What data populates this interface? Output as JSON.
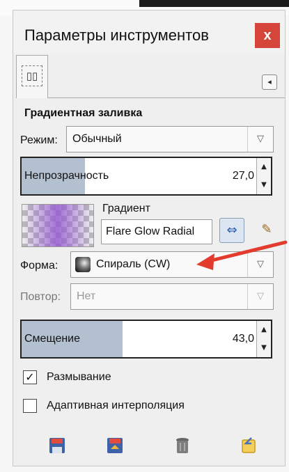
{
  "window": {
    "title": "Параметры инструментов",
    "close_label": "x"
  },
  "tab": {
    "icon": "tool-options-icon",
    "icon_glyph": "▯▯",
    "menu_glyph": "◂"
  },
  "tool": {
    "name": "Градиентная заливка"
  },
  "mode": {
    "label": "Режим:",
    "value": "Обычный"
  },
  "opacity": {
    "label": "Непрозрачность",
    "value": "27,0",
    "level_percent": 27
  },
  "gradient": {
    "label": "Градиент",
    "name": "Flare Glow Radial",
    "reverse_glyph": "⇔",
    "edit_glyph": "✎"
  },
  "shape": {
    "label": "Форма:",
    "value": "Спираль (CW)"
  },
  "repeat": {
    "label": "Повтор:",
    "value": "Нет"
  },
  "offset": {
    "label": "Смещение",
    "value": "43,0",
    "level_percent": 43
  },
  "options": [
    {
      "label": "Размывание",
      "checked": true,
      "check_glyph": "✓"
    },
    {
      "label": "Адаптивная интерполяция",
      "checked": false,
      "check_glyph": ""
    }
  ],
  "bottom_icons": [
    "save-preset-icon",
    "restore-preset-icon",
    "delete-preset-icon",
    "reset-icon"
  ],
  "colors": {
    "close_bg": "#d6453a",
    "slider_fill": "#b3c0cf",
    "annotation_arrow": "#e33b2e"
  }
}
